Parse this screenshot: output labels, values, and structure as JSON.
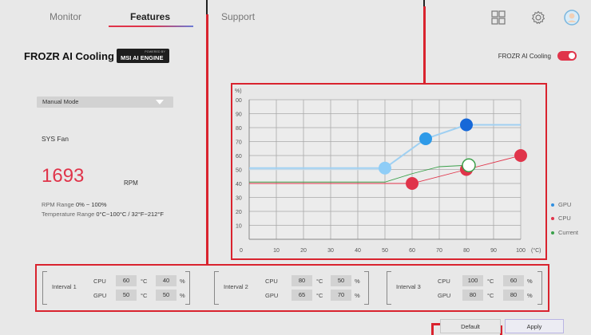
{
  "tabs": [
    {
      "label": "Monitor",
      "active": false
    },
    {
      "label": "Features",
      "active": true
    },
    {
      "label": "Support",
      "active": false
    }
  ],
  "top_icons": [
    "grid-icon",
    "gear-icon",
    "avatar-icon"
  ],
  "page": {
    "title": "FROZR AI Cooling",
    "engine_badge_sup": "POWERED BY",
    "engine_badge": "MSI AI ENGINE",
    "toggle_label": "FROZR AI Cooling",
    "toggle_on": true
  },
  "fan": {
    "mode": "Manual Mode",
    "name": "SYS Fan",
    "rpm": "1693",
    "rpm_unit": "RPM",
    "rpm_range_label": "RPM Range",
    "rpm_range_value": "0% ~ 100%",
    "temp_range_label": "Temperature Range",
    "temp_range_value": "0°C~100°C / 32°F~212°F"
  },
  "legend": [
    {
      "label": "GPU",
      "color": "#2f8fe0"
    },
    {
      "label": "CPU",
      "color": "#e0344a"
    },
    {
      "label": "Current",
      "color": "#3aa04a"
    }
  ],
  "chart_data": {
    "type": "line",
    "ylabel": "%)",
    "xlabel_unit": "(°C)",
    "x_ticks": [
      0,
      10,
      20,
      30,
      40,
      50,
      60,
      70,
      80,
      90,
      100
    ],
    "y_ticks": [
      "00",
      "90",
      "80",
      "70",
      "60",
      "50",
      "40",
      "30",
      "20",
      "10"
    ],
    "xlim": [
      0,
      100
    ],
    "ylim": [
      0,
      100
    ],
    "series": [
      {
        "name": "GPU",
        "color": "#2f8fe0",
        "light_color": "#9fd0f2",
        "x": [
          0,
          50,
          65,
          80,
          100
        ],
        "y": [
          51,
          51,
          72,
          82,
          82
        ],
        "points": [
          [
            50,
            51
          ],
          [
            65,
            72
          ],
          [
            80,
            82
          ]
        ]
      },
      {
        "name": "CPU",
        "color": "#e0344a",
        "light_color": "#e0344a",
        "x": [
          0,
          60,
          80,
          100
        ],
        "y": [
          40,
          40,
          50,
          60
        ],
        "points": [
          [
            60,
            40
          ],
          [
            80,
            50
          ],
          [
            100,
            60
          ]
        ]
      },
      {
        "name": "Current",
        "color": "#3aa04a",
        "x": [
          0,
          50,
          60,
          70,
          80
        ],
        "y": [
          41,
          41,
          47,
          52,
          53
        ],
        "points": [
          [
            80,
            53
          ]
        ]
      }
    ]
  },
  "intervals": [
    {
      "name": "Interval 1",
      "cpu_label": "CPU",
      "gpu_label": "GPU",
      "cpu_temp": "60",
      "cpu_pct": "40",
      "gpu_temp": "50",
      "gpu_pct": "50",
      "temp_unit": "°C",
      "pct_unit": "%"
    },
    {
      "name": "Interval 2",
      "cpu_label": "CPU",
      "gpu_label": "GPU",
      "cpu_temp": "80",
      "cpu_pct": "50",
      "gpu_temp": "65",
      "gpu_pct": "70",
      "temp_unit": "°C",
      "pct_unit": "%"
    },
    {
      "name": "Interval 3",
      "cpu_label": "CPU",
      "gpu_label": "GPU",
      "cpu_temp": "100",
      "cpu_pct": "60",
      "gpu_temp": "80",
      "gpu_pct": "80",
      "temp_unit": "°C",
      "pct_unit": "%"
    }
  ],
  "buttons": {
    "default": "Default",
    "apply": "Apply"
  }
}
